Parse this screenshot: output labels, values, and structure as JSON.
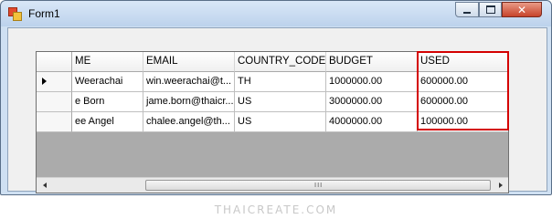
{
  "window": {
    "title": "Form1"
  },
  "controls": {
    "minimize_icon": "minimize-icon",
    "maximize_icon": "maximize-icon",
    "close_icon": "close-icon"
  },
  "grid": {
    "columns": [
      "ME",
      "EMAIL",
      "COUNTRY_CODE",
      "BUDGET",
      "USED"
    ],
    "rows": [
      [
        "Weerachai",
        "win.weerachai@t...",
        "TH",
        "1000000.00",
        "600000.00"
      ],
      [
        "e Born",
        "jame.born@thaicr...",
        "US",
        "3000000.00",
        "600000.00"
      ],
      [
        "ee Angel",
        "chalee.angel@th...",
        "US",
        "4000000.00",
        "100000.00"
      ]
    ],
    "current_row": 0,
    "highlight_color": "#d40000"
  },
  "scrollbar": {
    "left_icon": "arrow-left-icon",
    "right_icon": "arrow-right-icon",
    "grip": "III"
  },
  "watermark": "THAICREATE.COM"
}
